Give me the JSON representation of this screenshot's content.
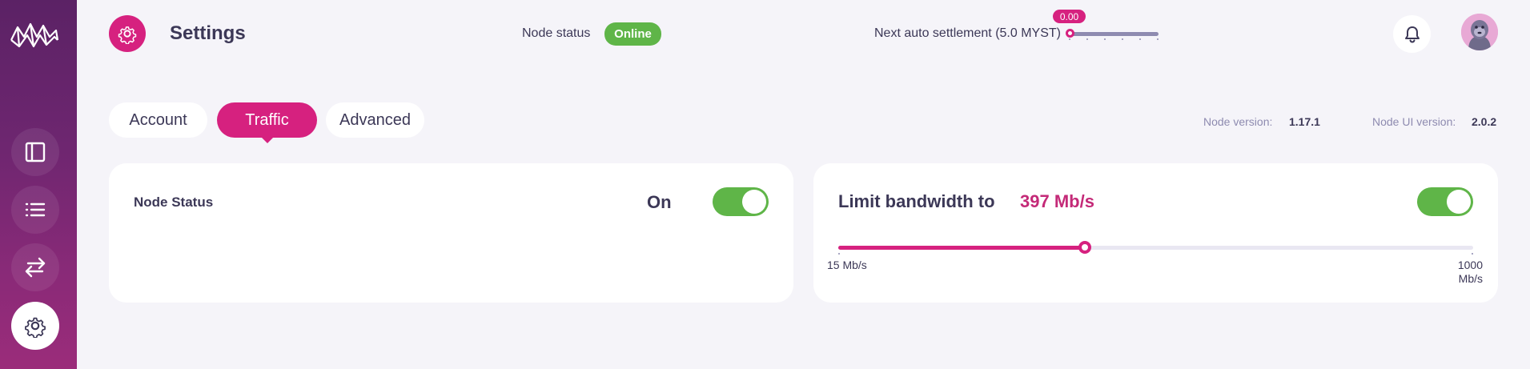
{
  "header": {
    "title": "Settings",
    "node_status_label": "Node status",
    "node_status_value": "Online",
    "settlement_label": "Next auto settlement (5.0 MYST)",
    "settlement_value": "0.00",
    "settlement_progress": 0.0
  },
  "sidebar": {
    "items": [
      {
        "icon": "dashboard-icon"
      },
      {
        "icon": "list-icon"
      },
      {
        "icon": "transactions-icon"
      },
      {
        "icon": "gear-icon",
        "active": true
      }
    ]
  },
  "tabs": [
    {
      "label": "Account"
    },
    {
      "label": "Traffic",
      "active": true
    },
    {
      "label": "Advanced"
    }
  ],
  "versions": {
    "node_label": "Node version:",
    "node_value": "1.17.1",
    "ui_label": "Node UI version:",
    "ui_value": "2.0.2"
  },
  "node_status_card": {
    "title": "Node Status",
    "state_label": "On",
    "enabled": true
  },
  "bandwidth_card": {
    "title": "Limit bandwidth to",
    "value_label": "397 Mb/s",
    "enabled": true,
    "min_label": "15 Mb/s",
    "max_label": "1000 Mb/s",
    "min": 15,
    "max": 1000,
    "value": 397
  },
  "colors": {
    "accent": "#d6217f",
    "success": "#5fb548",
    "text": "#3c3857",
    "muted": "#8e8bb0",
    "background": "#f5f4f9"
  }
}
